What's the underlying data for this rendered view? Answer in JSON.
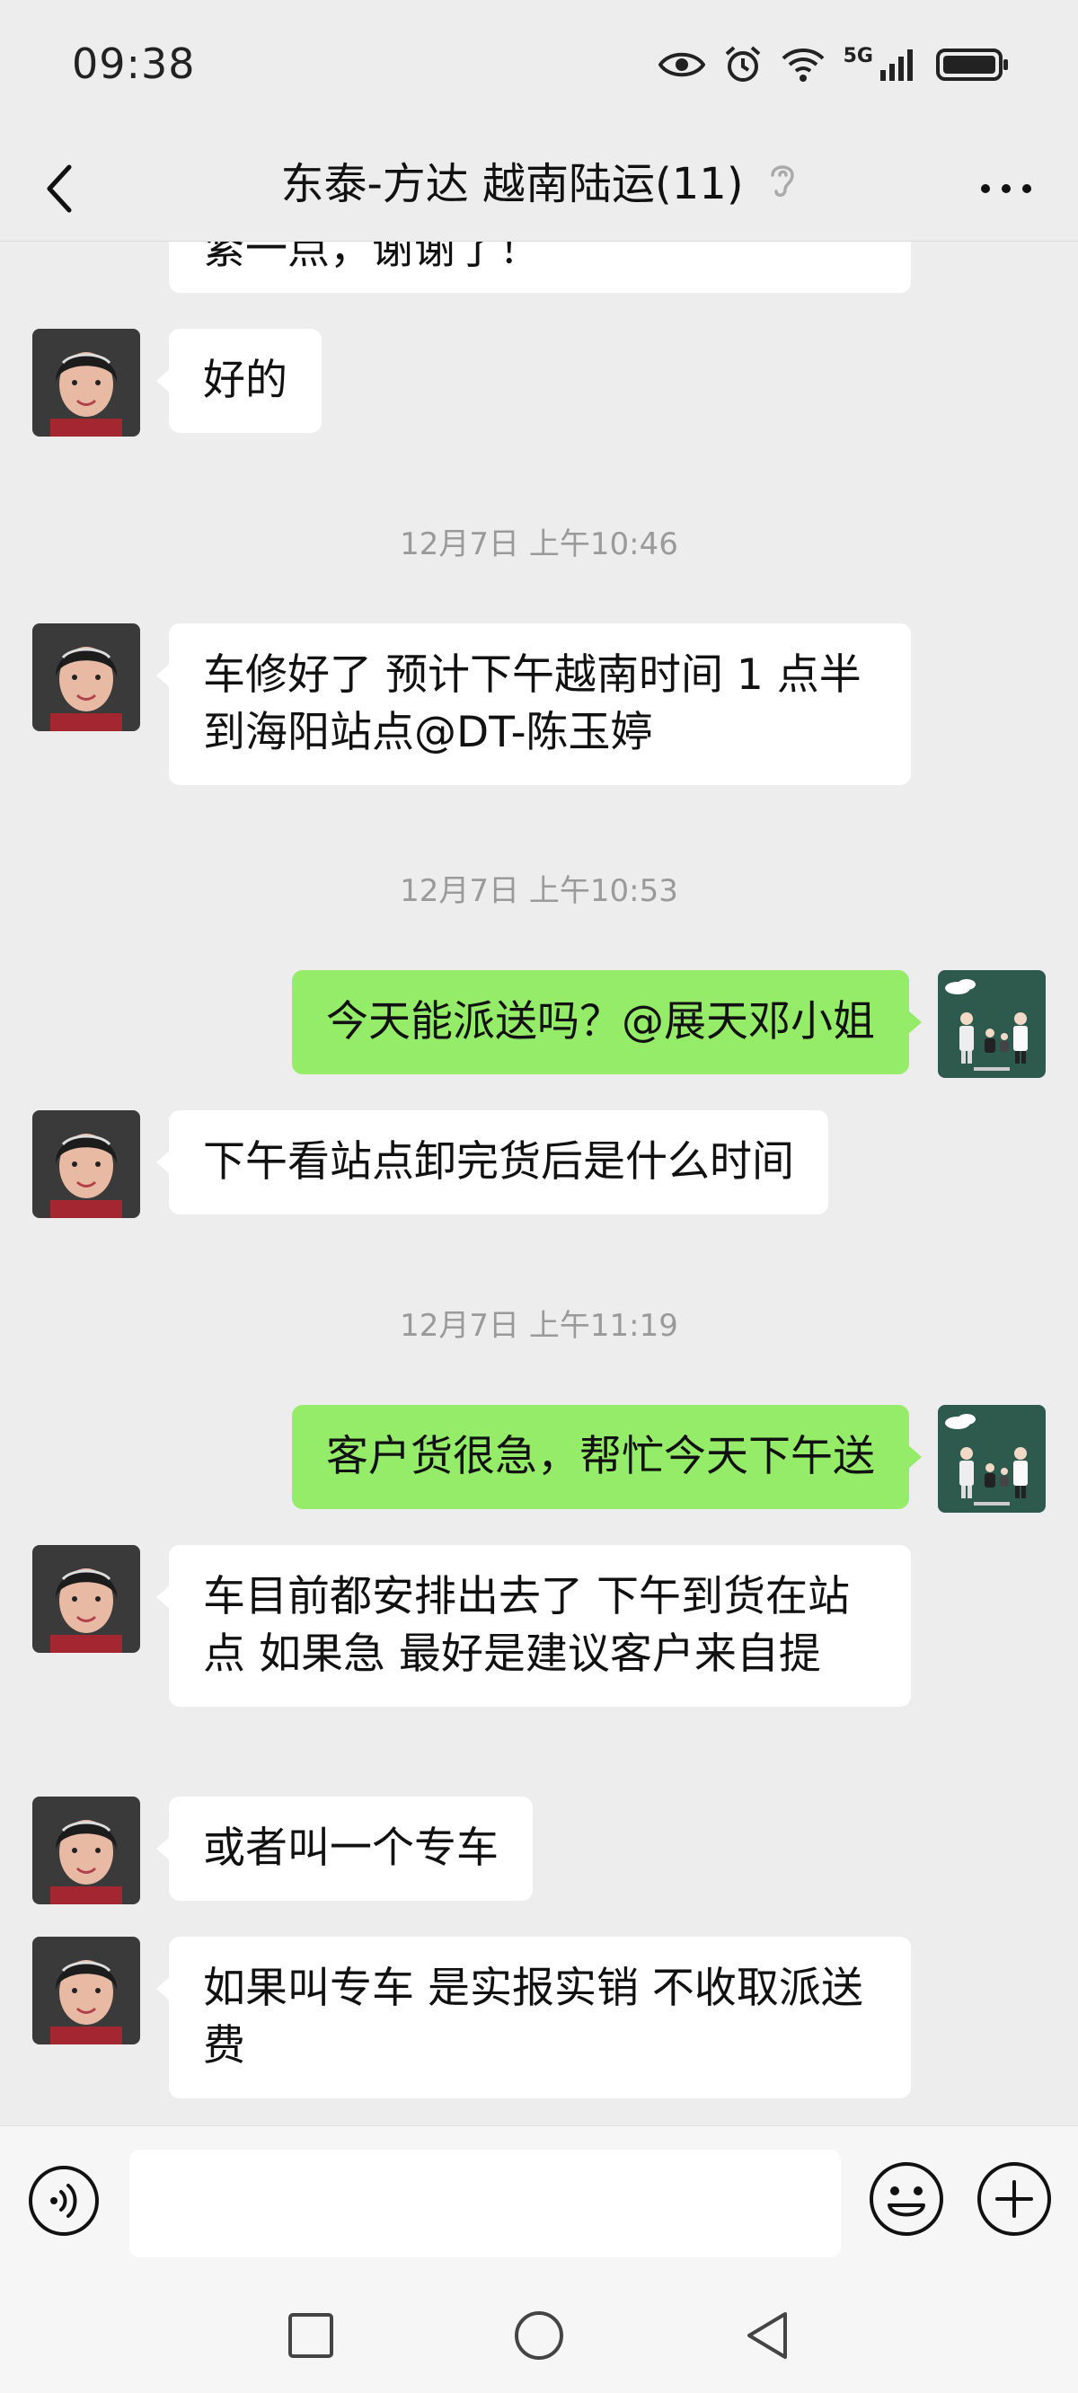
{
  "status_bar": {
    "time": "09:38",
    "network": "5G"
  },
  "header": {
    "title": "东泰-方达 越南陆运(11)"
  },
  "messages": [
    {
      "type": "received",
      "text": "紧一点，谢谢了！"
    },
    {
      "type": "received",
      "text": "好的"
    },
    {
      "type": "time",
      "text": "12月7日 上午10:46"
    },
    {
      "type": "received",
      "text": "车修好了  预计下午越南时间 1 点半到海阳站点@DT-陈玉婷"
    },
    {
      "type": "time",
      "text": "12月7日 上午10:53"
    },
    {
      "type": "sent",
      "text": "今天能派送吗？@展天邓小姐"
    },
    {
      "type": "received",
      "text": "下午看站点卸完货后是什么时间"
    },
    {
      "type": "time",
      "text": "12月7日 上午11:19"
    },
    {
      "type": "sent",
      "text": "客户货很急，帮忙今天下午送"
    },
    {
      "type": "received",
      "text": "车目前都安排出去了  下午到货在站点  如果急  最好是建议客户来自提"
    },
    {
      "type": "received",
      "text": "或者叫一个专车"
    },
    {
      "type": "received",
      "text": "如果叫专车  是实报实销  不收取派送费"
    }
  ],
  "input": {
    "value": "",
    "placeholder": ""
  },
  "colors": {
    "background": "#ededed",
    "sent_bubble": "#95ec69",
    "received_bubble": "#ffffff"
  },
  "icons": [
    "back-arrow-icon",
    "ear-icon",
    "more-icon",
    "voice-icon",
    "emoji-icon",
    "plus-icon",
    "square-nav-icon",
    "circle-nav-icon",
    "triangle-nav-icon"
  ]
}
